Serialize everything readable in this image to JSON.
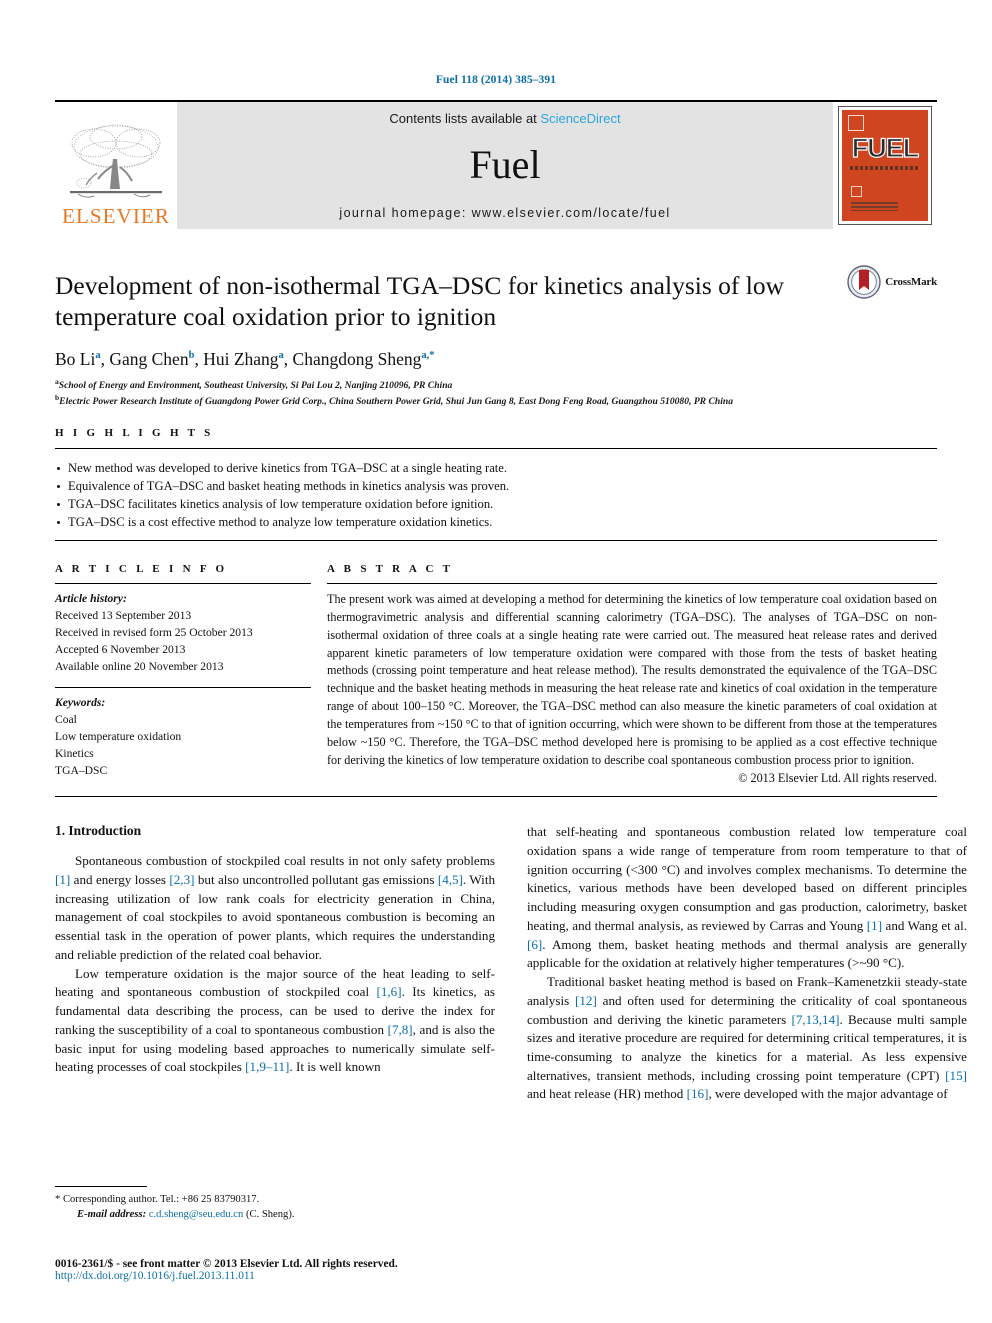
{
  "running_head": "Fuel 118 (2014) 385–391",
  "masthead": {
    "publisher_name": "ELSEVIER",
    "contents_prefix": "Contents lists available at ",
    "contents_link": "ScienceDirect",
    "journal_name": "Fuel",
    "homepage": "journal homepage: www.elsevier.com/locate/fuel",
    "cover_title": "FUEL"
  },
  "article": {
    "title": "Development of non-isothermal TGA–DSC for kinetics analysis of low temperature coal oxidation prior to ignition",
    "crossmark_label": "CrossMark",
    "authors": [
      {
        "name": "Bo Li",
        "sup": "a",
        "sep": ", "
      },
      {
        "name": "Gang Chen",
        "sup": "b",
        "sep": ", "
      },
      {
        "name": "Hui Zhang",
        "sup": "a",
        "sep": ", "
      },
      {
        "name": "Changdong Sheng",
        "sup": "a,*",
        "sep": ""
      }
    ],
    "affiliations": [
      {
        "marker": "a",
        "text": "School of Energy and Environment, Southeast University, Si Pai Lou 2, Nanjing 210096, PR China"
      },
      {
        "marker": "b",
        "text": "Electric Power Research Institute of Guangdong Power Grid Corp., China Southern Power Grid, Shui Jun Gang 8, East Dong Feng Road, Guangzhou 510080, PR China"
      }
    ]
  },
  "highlights": {
    "heading": "H I G H L I G H T S",
    "items": [
      "New method was developed to derive kinetics from TGA–DSC at a single heating rate.",
      "Equivalence of TGA–DSC and basket heating methods in kinetics analysis was proven.",
      "TGA–DSC facilitates kinetics analysis of low temperature oxidation before ignition.",
      "TGA–DSC is a cost effective method to analyze low temperature oxidation kinetics."
    ]
  },
  "article_info": {
    "heading": "A R T I C L E    I N F O",
    "history_label": "Article history:",
    "history": [
      "Received 13 September 2013",
      "Received in revised form 25 October 2013",
      "Accepted 6 November 2013",
      "Available online 20 November 2013"
    ],
    "keywords_label": "Keywords:",
    "keywords": [
      "Coal",
      "Low temperature oxidation",
      "Kinetics",
      "TGA–DSC"
    ]
  },
  "abstract": {
    "heading": "A B S T R A C T",
    "text": "The present work was aimed at developing a method for determining the kinetics of low temperature coal oxidation based on thermogravimetric analysis and differential scanning calorimetry (TGA–DSC). The analyses of TGA–DSC on non-isothermal oxidation of three coals at a single heating rate were carried out. The measured heat release rates and derived apparent kinetic parameters of low temperature oxidation were compared with those from the tests of basket heating methods (crossing point temperature and heat release method). The results demonstrated the equivalence of the TGA–DSC technique and the basket heating methods in measuring the heat release rate and kinetics of coal oxidation in the temperature range of about 100–150 °C. Moreover, the TGA–DSC method can also measure the kinetic parameters of coal oxidation at the temperatures from ~150 °C to that of ignition occurring, which were shown to be different from those at the temperatures below ~150 °C. Therefore, the TGA–DSC method developed here is promising to be applied as a cost effective technique for deriving the kinetics of low temperature oxidation to describe coal spontaneous combustion process prior to ignition.",
    "copyright": "© 2013 Elsevier Ltd. All rights reserved."
  },
  "introduction": {
    "section_title": "1. Introduction",
    "left_para_1": "Spontaneous combustion of stockpiled coal results in not only safety problems [1] and energy losses [2,3] but also uncontrolled pollutant gas emissions [4,5]. With increasing utilization of low rank coals for electricity generation in China, management of coal stockpiles to avoid spontaneous combustion is becoming an essential task in the operation of power plants, which requires the understanding and reliable prediction of the related coal behavior.",
    "left_para_2": "Low temperature oxidation is the major source of the heat leading to self-heating and spontaneous combustion of stockpiled coal [1,6]. Its kinetics, as fundamental data describing the process, can be used to derive the index for ranking the susceptibility of a coal to spontaneous combustion [7,8], and is also the basic input for using modeling based approaches to numerically simulate self-heating processes of coal stockpiles [1,9–11]. It is well known",
    "right_para_1": "that self-heating and spontaneous combustion related low temperature coal oxidation spans a wide range of temperature from room temperature to that of ignition occurring (<300 °C) and involves complex mechanisms. To determine the kinetics, various methods have been developed based on different principles including measuring oxygen consumption and gas production, calorimetry, basket heating, and thermal analysis, as reviewed by Carras and Young [1] and Wang et al. [6]. Among them, basket heating methods and thermal analysis are generally applicable for the oxidation at relatively higher temperatures (>~90 °C).",
    "right_para_2": "Traditional basket heating method is based on Frank–Kamenetzkii steady-state analysis [12] and often used for determining the criticality of coal spontaneous combustion and deriving the kinetic parameters [7,13,14]. Because multi sample sizes and iterative procedure are required for determining critical temperatures, it is time-consuming to analyze the kinetics for a material. As less expensive alternatives, transient methods, including crossing point temperature (CPT) [15] and heat release (HR) method [16], were developed with the major advantage of"
  },
  "footnote": {
    "corresponding": "* Corresponding author. Tel.: +86 25 83790317.",
    "email_label": "E-mail address:",
    "email": "c.d.sheng@seu.edu.cn",
    "email_suffix": " (C. Sheng)."
  },
  "copyright_block": {
    "line1": "0016-2361/$ - see front matter © 2013 Elsevier Ltd. All rights reserved.",
    "doi": "http://dx.doi.org/10.1016/j.fuel.2013.11.011"
  },
  "colors": {
    "link": "#0b6ea8",
    "sciencedirect": "#2ba6de",
    "elsevier_orange": "#e87722",
    "cover_red": "#cf4520"
  }
}
